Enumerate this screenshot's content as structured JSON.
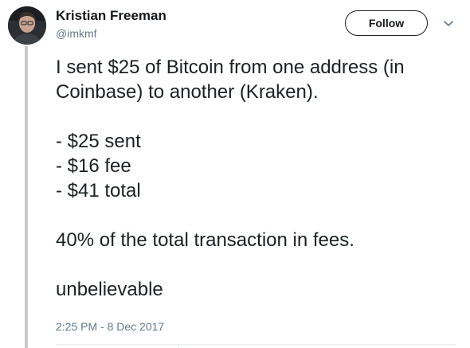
{
  "tweet": {
    "author": {
      "name": "Kristian Freeman",
      "handle": "@imkmf"
    },
    "follow_label": "Follow",
    "text_lines": [
      "I sent $25 of Bitcoin from one address (in",
      "Coinbase) to another (Kraken).",
      "",
      "- $25 sent",
      "- $16 fee",
      "- $41 total",
      "",
      "40% of the total transaction in fees.",
      "",
      "unbelievable"
    ],
    "timestamp": "2:25 PM - 8 Dec 2017"
  },
  "icons": {
    "avatar": "avatar-photo",
    "menu": "chevron-down-icon"
  },
  "colors": {
    "text_primary": "#14171a",
    "text_secondary": "#657786",
    "thread_line": "#c9c9c9"
  }
}
